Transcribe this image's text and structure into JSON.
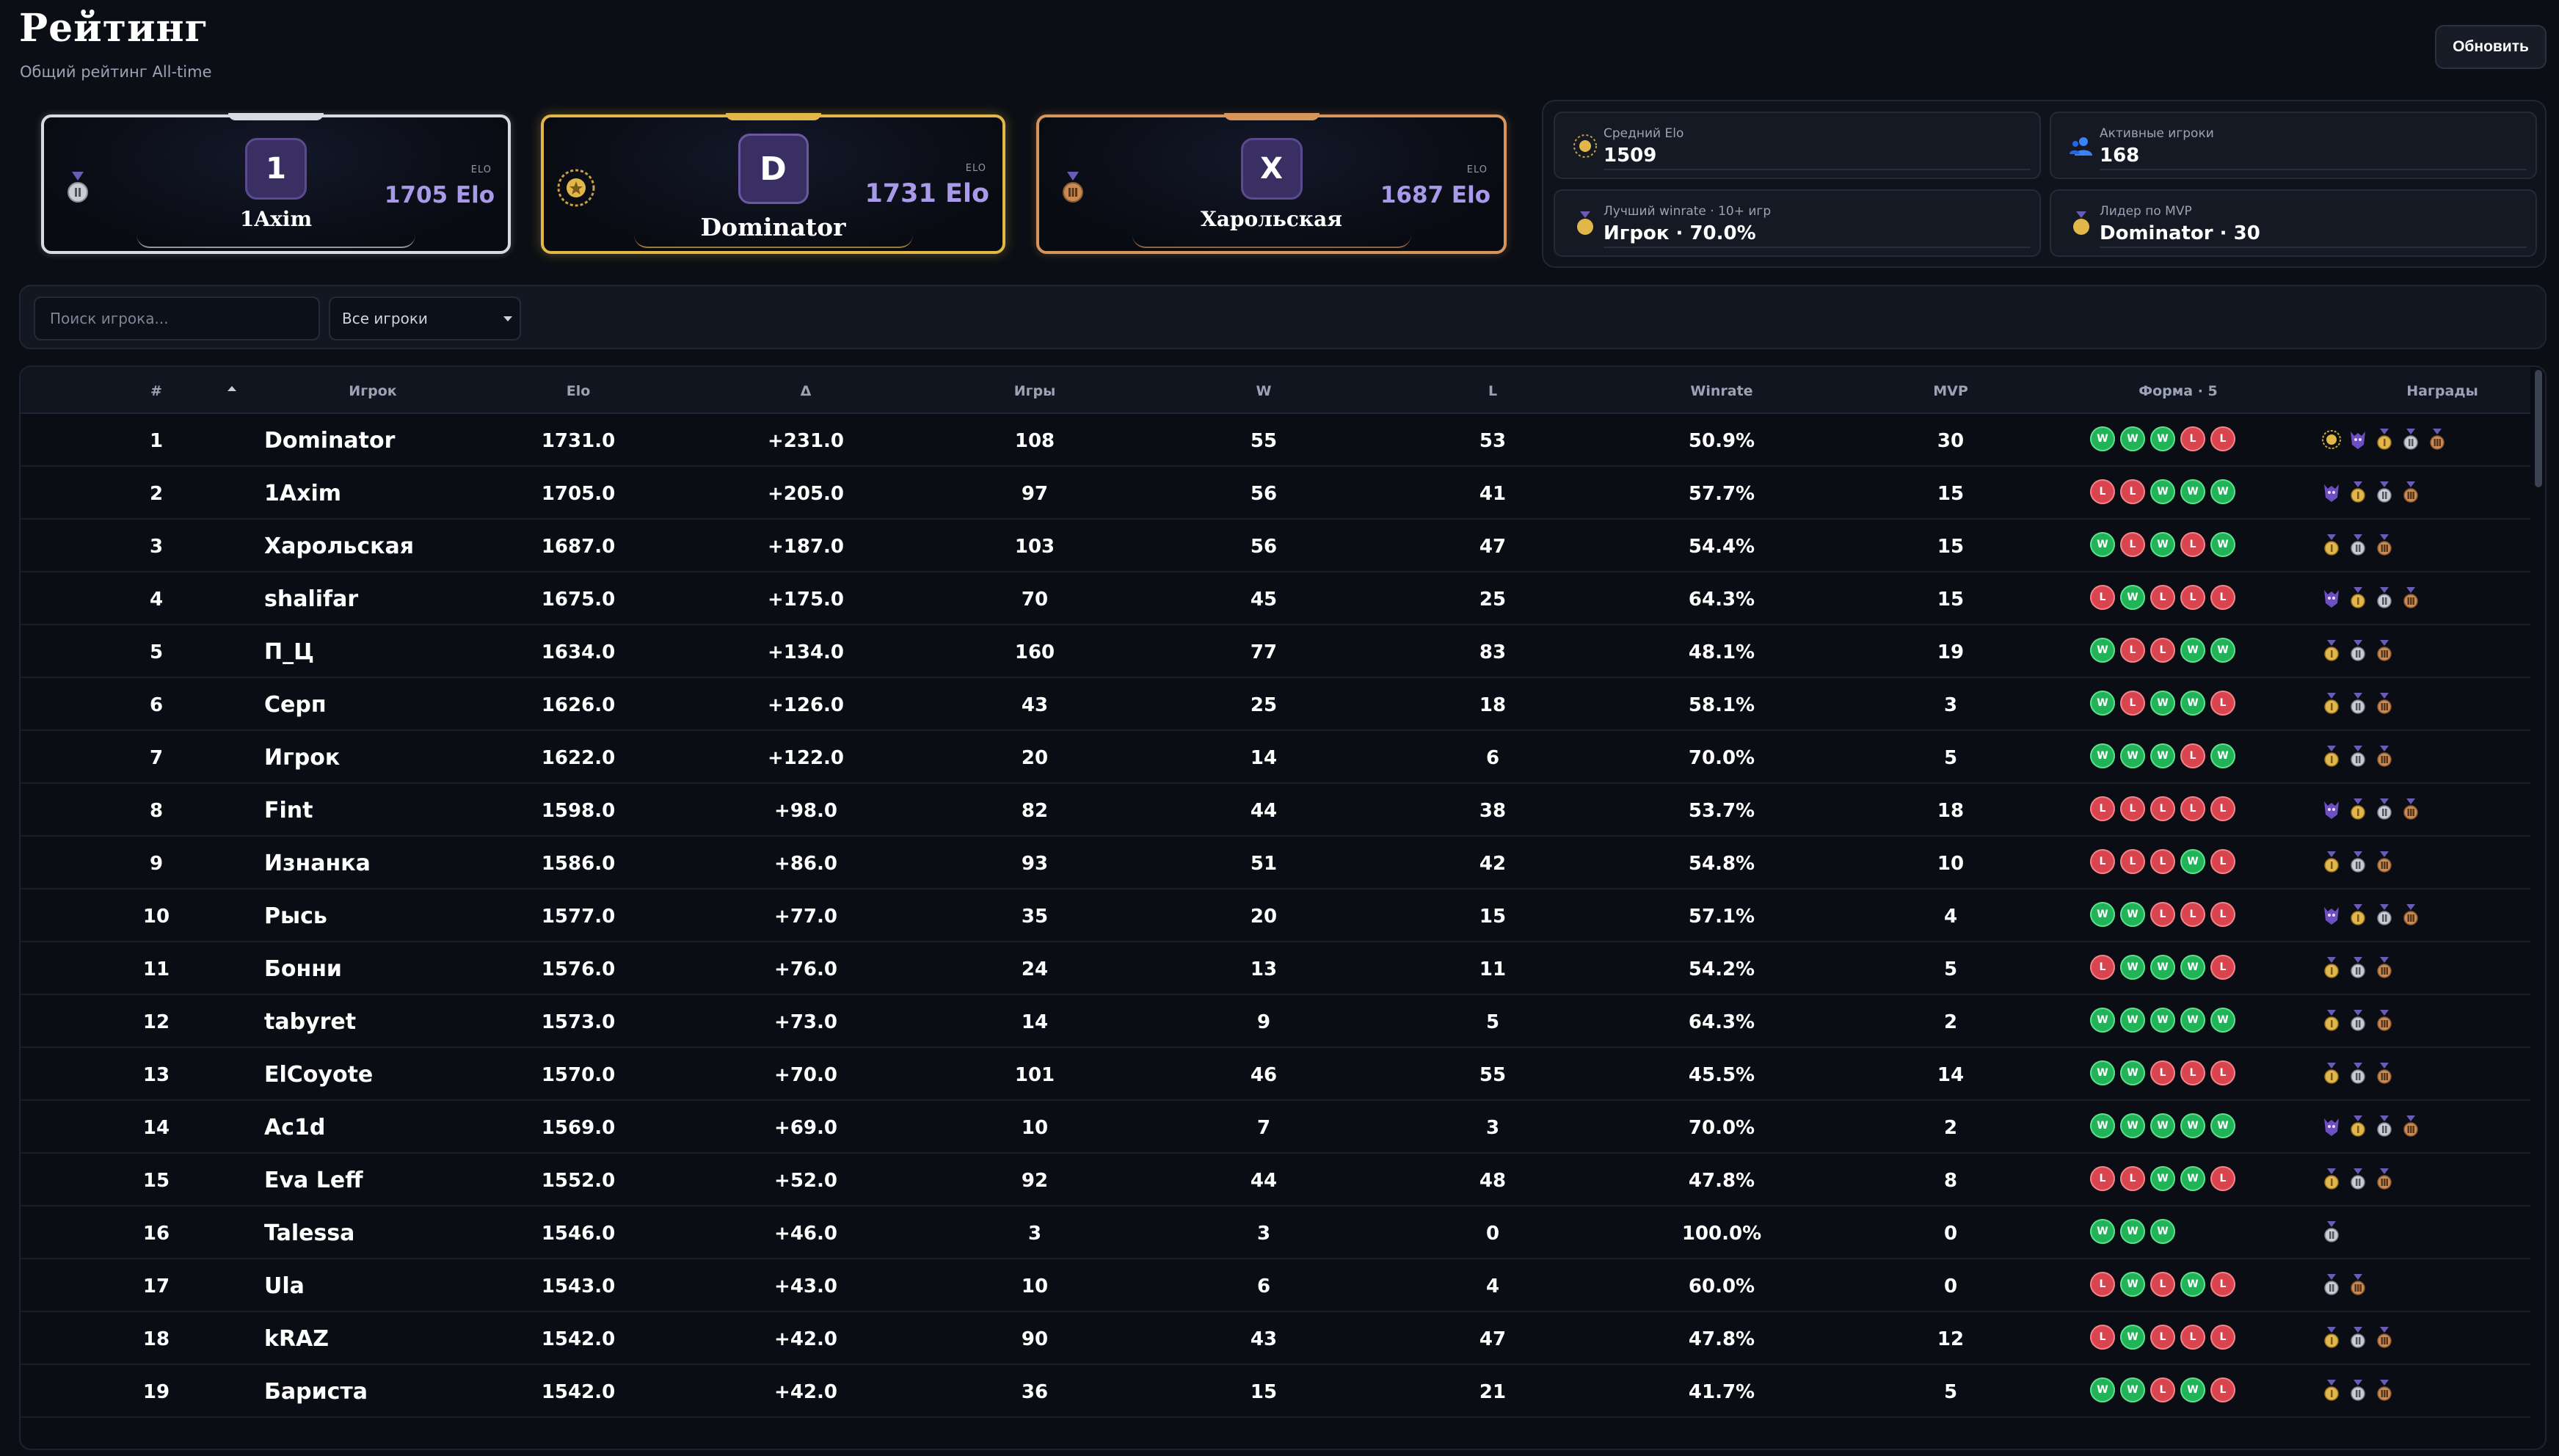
{
  "header": {
    "title": "Рейтинг",
    "subtitle": "Общий рейтинг All-time",
    "refresh_label": "Обновить"
  },
  "podium": {
    "elo_label": "ELO",
    "second": {
      "initial": "1",
      "name": "1Axim",
      "elo": "1705 Elo",
      "medal": "silver-medal-icon"
    },
    "first": {
      "initial": "D",
      "name": "Dominator",
      "elo": "1731 Elo",
      "medal": "gold-laurel-icon"
    },
    "third": {
      "initial": "X",
      "name": "Харольская",
      "elo": "1687 Elo",
      "medal": "bronze-medal-icon"
    }
  },
  "stats": {
    "avg_elo": {
      "label": "Средний Elo",
      "value": "1509",
      "icon": "sun-badge-icon"
    },
    "active": {
      "label": "Активные игроки",
      "value": "168",
      "icon": "users-icon"
    },
    "best_winrate": {
      "label": "Лучший winrate · 10+ игр",
      "value": "Игрок · 70.0%",
      "icon": "medal-icon"
    },
    "mvp_leader": {
      "label": "Лидер по MVP",
      "value": "Dominator · 30",
      "icon": "medal-icon"
    }
  },
  "filters": {
    "search_placeholder": "Поиск игрока...",
    "player_filter": "Все игроки"
  },
  "table": {
    "columns": [
      "#",
      "Игрок",
      "Elo",
      "Δ",
      "Игры",
      "W",
      "L",
      "Winrate",
      "MVP",
      "Форма · 5",
      "Награды"
    ],
    "rows": [
      {
        "rank": "1",
        "name": "Dominator",
        "elo": "1731.0",
        "delta": "+231.0",
        "games": "108",
        "w": "55",
        "l": "53",
        "winrate": "50.9%",
        "mvp": "30",
        "form": [
          "W",
          "W",
          "W",
          "L",
          "L"
        ],
        "awards": [
          "laurel",
          "demon",
          "gold",
          "silver",
          "bronze"
        ]
      },
      {
        "rank": "2",
        "name": "1Axim",
        "elo": "1705.0",
        "delta": "+205.0",
        "games": "97",
        "w": "56",
        "l": "41",
        "winrate": "57.7%",
        "mvp": "15",
        "form": [
          "L",
          "L",
          "W",
          "W",
          "W"
        ],
        "awards": [
          "demon",
          "gold",
          "silver",
          "bronze"
        ]
      },
      {
        "rank": "3",
        "name": "Харольская",
        "elo": "1687.0",
        "delta": "+187.0",
        "games": "103",
        "w": "56",
        "l": "47",
        "winrate": "54.4%",
        "mvp": "15",
        "form": [
          "W",
          "L",
          "W",
          "L",
          "W"
        ],
        "awards": [
          "gold",
          "silver",
          "bronze"
        ]
      },
      {
        "rank": "4",
        "name": "shalifar",
        "elo": "1675.0",
        "delta": "+175.0",
        "games": "70",
        "w": "45",
        "l": "25",
        "winrate": "64.3%",
        "mvp": "15",
        "form": [
          "L",
          "W",
          "L",
          "L",
          "L"
        ],
        "awards": [
          "demon",
          "gold",
          "silver",
          "bronze"
        ]
      },
      {
        "rank": "5",
        "name": "П_Ц",
        "elo": "1634.0",
        "delta": "+134.0",
        "games": "160",
        "w": "77",
        "l": "83",
        "winrate": "48.1%",
        "mvp": "19",
        "form": [
          "W",
          "L",
          "L",
          "W",
          "W"
        ],
        "awards": [
          "gold",
          "silver",
          "bronze"
        ]
      },
      {
        "rank": "6",
        "name": "Серп",
        "elo": "1626.0",
        "delta": "+126.0",
        "games": "43",
        "w": "25",
        "l": "18",
        "winrate": "58.1%",
        "mvp": "3",
        "form": [
          "W",
          "L",
          "W",
          "W",
          "L"
        ],
        "awards": [
          "gold",
          "silver",
          "bronze"
        ]
      },
      {
        "rank": "7",
        "name": "Игрок",
        "elo": "1622.0",
        "delta": "+122.0",
        "games": "20",
        "w": "14",
        "l": "6",
        "winrate": "70.0%",
        "mvp": "5",
        "form": [
          "W",
          "W",
          "W",
          "L",
          "W"
        ],
        "awards": [
          "gold",
          "silver",
          "bronze"
        ]
      },
      {
        "rank": "8",
        "name": "Fint",
        "elo": "1598.0",
        "delta": "+98.0",
        "games": "82",
        "w": "44",
        "l": "38",
        "winrate": "53.7%",
        "mvp": "18",
        "form": [
          "L",
          "L",
          "L",
          "L",
          "L"
        ],
        "awards": [
          "demon",
          "gold",
          "silver",
          "bronze"
        ]
      },
      {
        "rank": "9",
        "name": "Изнанка",
        "elo": "1586.0",
        "delta": "+86.0",
        "games": "93",
        "w": "51",
        "l": "42",
        "winrate": "54.8%",
        "mvp": "10",
        "form": [
          "L",
          "L",
          "L",
          "W",
          "L"
        ],
        "awards": [
          "gold",
          "silver",
          "bronze"
        ]
      },
      {
        "rank": "10",
        "name": "Рысь",
        "elo": "1577.0",
        "delta": "+77.0",
        "games": "35",
        "w": "20",
        "l": "15",
        "winrate": "57.1%",
        "mvp": "4",
        "form": [
          "W",
          "W",
          "L",
          "L",
          "L"
        ],
        "awards": [
          "demon",
          "gold",
          "silver",
          "bronze"
        ]
      },
      {
        "rank": "11",
        "name": "Бонни",
        "elo": "1576.0",
        "delta": "+76.0",
        "games": "24",
        "w": "13",
        "l": "11",
        "winrate": "54.2%",
        "mvp": "5",
        "form": [
          "L",
          "W",
          "W",
          "W",
          "L"
        ],
        "awards": [
          "gold",
          "silver",
          "bronze"
        ]
      },
      {
        "rank": "12",
        "name": "tabyret",
        "elo": "1573.0",
        "delta": "+73.0",
        "games": "14",
        "w": "9",
        "l": "5",
        "winrate": "64.3%",
        "mvp": "2",
        "form": [
          "W",
          "W",
          "W",
          "W",
          "W"
        ],
        "awards": [
          "gold",
          "silver",
          "bronze"
        ]
      },
      {
        "rank": "13",
        "name": "ElCoyote",
        "elo": "1570.0",
        "delta": "+70.0",
        "games": "101",
        "w": "46",
        "l": "55",
        "winrate": "45.5%",
        "mvp": "14",
        "form": [
          "W",
          "W",
          "L",
          "L",
          "L"
        ],
        "awards": [
          "gold",
          "silver",
          "bronze"
        ]
      },
      {
        "rank": "14",
        "name": "Ac1d",
        "elo": "1569.0",
        "delta": "+69.0",
        "games": "10",
        "w": "7",
        "l": "3",
        "winrate": "70.0%",
        "mvp": "2",
        "form": [
          "W",
          "W",
          "W",
          "W",
          "W"
        ],
        "awards": [
          "demon",
          "gold",
          "silver",
          "bronze"
        ]
      },
      {
        "rank": "15",
        "name": "Eva Leff",
        "elo": "1552.0",
        "delta": "+52.0",
        "games": "92",
        "w": "44",
        "l": "48",
        "winrate": "47.8%",
        "mvp": "8",
        "form": [
          "L",
          "L",
          "W",
          "W",
          "L"
        ],
        "awards": [
          "gold",
          "silver",
          "bronze"
        ]
      },
      {
        "rank": "16",
        "name": "Talessa",
        "elo": "1546.0",
        "delta": "+46.0",
        "games": "3",
        "w": "3",
        "l": "0",
        "winrate": "100.0%",
        "mvp": "0",
        "form": [
          "W",
          "W",
          "W"
        ],
        "awards": [
          "silver"
        ]
      },
      {
        "rank": "17",
        "name": "Ula",
        "elo": "1543.0",
        "delta": "+43.0",
        "games": "10",
        "w": "6",
        "l": "4",
        "winrate": "60.0%",
        "mvp": "0",
        "form": [
          "L",
          "W",
          "L",
          "W",
          "L"
        ],
        "awards": [
          "silver",
          "bronze"
        ]
      },
      {
        "rank": "18",
        "name": "kRAZ",
        "elo": "1542.0",
        "delta": "+42.0",
        "games": "90",
        "w": "43",
        "l": "47",
        "winrate": "47.8%",
        "mvp": "12",
        "form": [
          "L",
          "W",
          "L",
          "L",
          "L"
        ],
        "awards": [
          "gold",
          "silver",
          "bronze"
        ]
      },
      {
        "rank": "19",
        "name": "Бариста",
        "elo": "1542.0",
        "delta": "+42.0",
        "games": "36",
        "w": "15",
        "l": "21",
        "winrate": "41.7%",
        "mvp": "5",
        "form": [
          "W",
          "W",
          "L",
          "W",
          "L"
        ],
        "awards": [
          "gold",
          "silver",
          "bronze"
        ]
      }
    ]
  },
  "colors": {
    "win": "#22b258",
    "loss": "#d8454f",
    "gold": "#e2b74a",
    "silver": "#d9dbe2",
    "bronze": "#d7955c",
    "accent": "#a89ae8"
  }
}
